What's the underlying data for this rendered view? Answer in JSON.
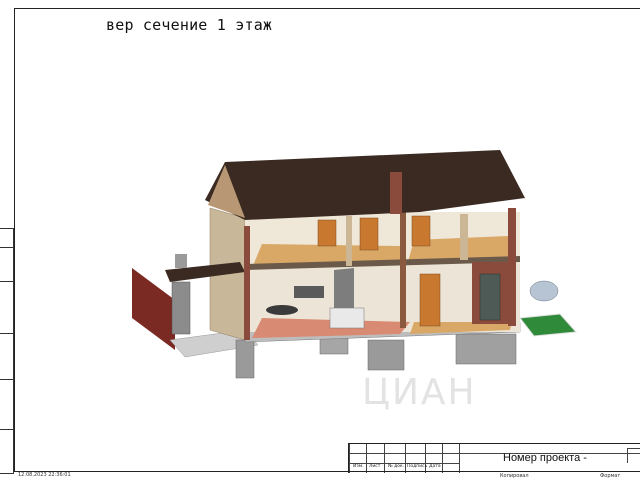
{
  "sheet_title": "вер сечение 1 этаж",
  "title_block": {
    "project_label": "Номер проекта -",
    "columns": [
      "Изм.",
      "Лист",
      "№ док.",
      "Подпись",
      "Дата"
    ],
    "copied_label": "Копировал",
    "format_label": "Формат",
    "date_stamp": "12.08.2023 22:36:01"
  },
  "watermark": "ЦИАН",
  "colors": {
    "roof": "#3b2a22",
    "wall_beige": "#d6c4a8",
    "floor_wood": "#d9a867",
    "floor_terracotta": "#d98a72",
    "brick": "#8a4b3c",
    "fence": "#7a2a22",
    "lawn": "#2f8a3a",
    "foundation": "#9a9a9a"
  }
}
